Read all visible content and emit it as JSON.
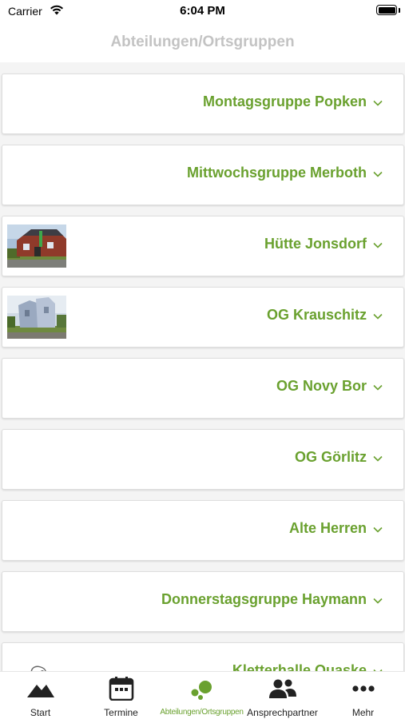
{
  "status": {
    "carrier": "Carrier",
    "time": "6:04 PM"
  },
  "nav": {
    "title": "Abteilungen/Ortsgruppen"
  },
  "colors": {
    "accent": "#6aa12f",
    "title": "#c3c3c3",
    "text": "#222222"
  },
  "groups": [
    {
      "label": "Montagsgruppe Popken"
    },
    {
      "label": "Mittwochsgruppe Merboth"
    },
    {
      "label": "Hütte Jonsdorf"
    },
    {
      "label": "OG Krauschitz"
    },
    {
      "label": "OG Novy Bor"
    },
    {
      "label": "OG Görlitz"
    },
    {
      "label": "Alte Herren"
    },
    {
      "label": "Donnerstagsgruppe Haymann"
    },
    {
      "label": "Kletterhalle Quaske"
    }
  ],
  "tabs": [
    {
      "label": "Start",
      "icon": "mountain-icon"
    },
    {
      "label": "Termine",
      "icon": "calendar-icon"
    },
    {
      "label": "Abteilungen/Ortsgruppen",
      "icon": "groups-dots-icon",
      "active": true
    },
    {
      "label": "Ansprechpartner",
      "icon": "people-icon"
    },
    {
      "label": "Mehr",
      "icon": "more-dots-icon"
    }
  ]
}
